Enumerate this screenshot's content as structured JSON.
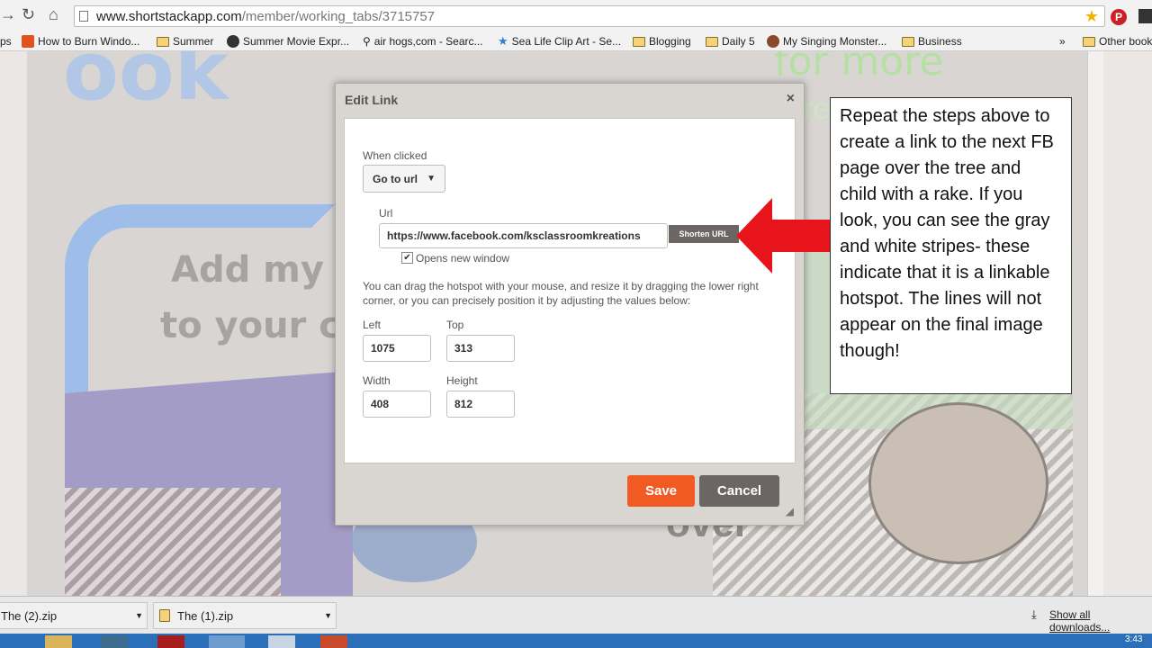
{
  "browser": {
    "url_host": "www.shortstackapp.com",
    "url_path": "/member/working_tabs/3715757",
    "apps_fragment": "ps",
    "bookmarks": [
      {
        "label": "How to Burn Windo...",
        "icon": "site-icon"
      },
      {
        "label": "Summer",
        "icon": "folder-icon"
      },
      {
        "label": "Summer Movie Expr...",
        "icon": "site-icon"
      },
      {
        "label": "air hogs,com - Searc...",
        "icon": "search-icon"
      },
      {
        "label": "Sea Life Clip Art - Se...",
        "icon": "star-site-icon"
      },
      {
        "label": "Blogging",
        "icon": "folder-icon"
      },
      {
        "label": "Daily 5",
        "icon": "folder-icon"
      },
      {
        "label": "My Singing Monster...",
        "icon": "site-icon"
      },
      {
        "label": "Business",
        "icon": "folder-icon"
      }
    ],
    "overflow": "»",
    "other_bookmarks": "Other book"
  },
  "background_text": {
    "line1": "Add my fr",
    "line2": "to your col",
    "top_left": "ook",
    "top_right": "for more",
    "right_small": "re",
    "bottom_word": "over"
  },
  "dialog": {
    "title": "Edit Link",
    "close": "×",
    "when_clicked_label": "When clicked",
    "select_value": "Go to url",
    "url_label": "Url",
    "url_value": "https://www.facebook.com/ksclassroomkreations",
    "shorten_label": "Shorten URL",
    "new_window_label": "Opens new window",
    "help_text": "You can drag the hotspot with your mouse, and resize it by dragging the lower right corner, or you can precisely position it by adjusting the values below:",
    "left_label": "Left",
    "left_value": "1075",
    "top_label": "Top",
    "top_value": "313",
    "width_label": "Width",
    "width_value": "408",
    "height_label": "Height",
    "height_value": "812",
    "save_label": "Save",
    "cancel_label": "Cancel"
  },
  "note": "Repeat the steps above to create a link to the next FB page over the tree and child with a rake.  If you look, you can see the gray and white stripes- these indicate that it is a linkable hotspot.  The lines will not appear on the final image though!",
  "downloads": {
    "item1": "The (2).zip",
    "item2": "The (1).zip",
    "show_all": "Show all downloads..."
  },
  "clock": "3:43",
  "colors": {
    "save": "#f15a22",
    "arrow": "#e8141b",
    "cancel": "#6b6663"
  }
}
